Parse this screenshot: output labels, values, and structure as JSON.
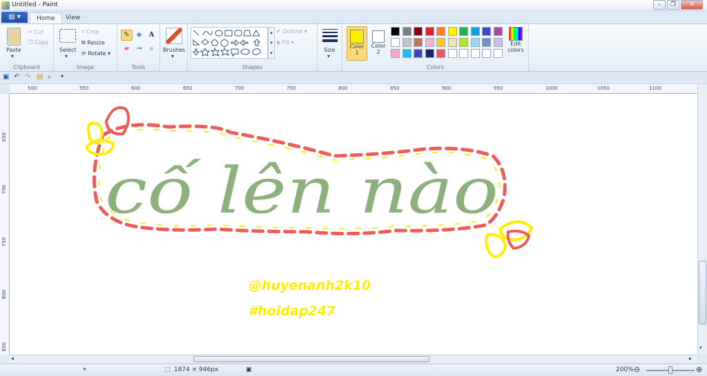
{
  "window": {
    "title": "Untitled - Paint"
  },
  "tabs": [
    "Home",
    "View"
  ],
  "clipboard": {
    "paste": "Paste",
    "cut": "Cut",
    "copy": "Copy",
    "label": "Clipboard"
  },
  "image": {
    "select": "Select",
    "crop": "Crop",
    "resize": "Resize",
    "rotate": "Rotate",
    "label": "Image"
  },
  "tools": {
    "label": "Tools"
  },
  "brushes": {
    "label": "Brushes"
  },
  "shapes": {
    "outline": "Outline",
    "fill": "Fill",
    "label": "Shapes"
  },
  "size": {
    "label": "Size"
  },
  "colors": {
    "color1_label": "Color",
    "color1_num": "1",
    "color2_label": "Color",
    "color2_num": "2",
    "edit_label": "Edit",
    "edit_label2": "colors",
    "label": "Colors",
    "color1": "#ffee00",
    "color2": "#ffffff",
    "palette_row1": [
      "#000000",
      "#7f7f7f",
      "#880015",
      "#ed1c24",
      "#ff7f27",
      "#fff200",
      "#22b14c",
      "#00a2e8",
      "#3f48cc",
      "#a349a4"
    ],
    "palette_row2": [
      "#ffffff",
      "#c3c3c3",
      "#b97a57",
      "#ffaec9",
      "#ffc90e",
      "#efe4b0",
      "#b5e61d",
      "#99d9ea",
      "#7092be",
      "#c8bfe7"
    ],
    "palette_row3": [
      "#fea3c9",
      "#22b9ef",
      "#3c47b9",
      "#1c246b",
      "#f0555c",
      "#ffffff",
      "#ffffff",
      "#ffffff",
      "#ffffff",
      "#ffffff"
    ]
  },
  "ruler_top": [
    "500",
    "550",
    "600",
    "650",
    "700",
    "750",
    "800",
    "850",
    "900",
    "950",
    "1000",
    "1050",
    "1100"
  ],
  "ruler_left": [
    "650",
    "700",
    "750",
    "800",
    "850"
  ],
  "canvas": {
    "lettering": "cố lên nào",
    "handle": "@huyenanh2k10",
    "hashtag": "#hoidap247",
    "ink_green": "#8db07c",
    "ink_red": "#ee5b5b",
    "ink_yellow": "#ffee00"
  },
  "status": {
    "dimensions": "1874 × 946px",
    "zoom": "200%"
  }
}
